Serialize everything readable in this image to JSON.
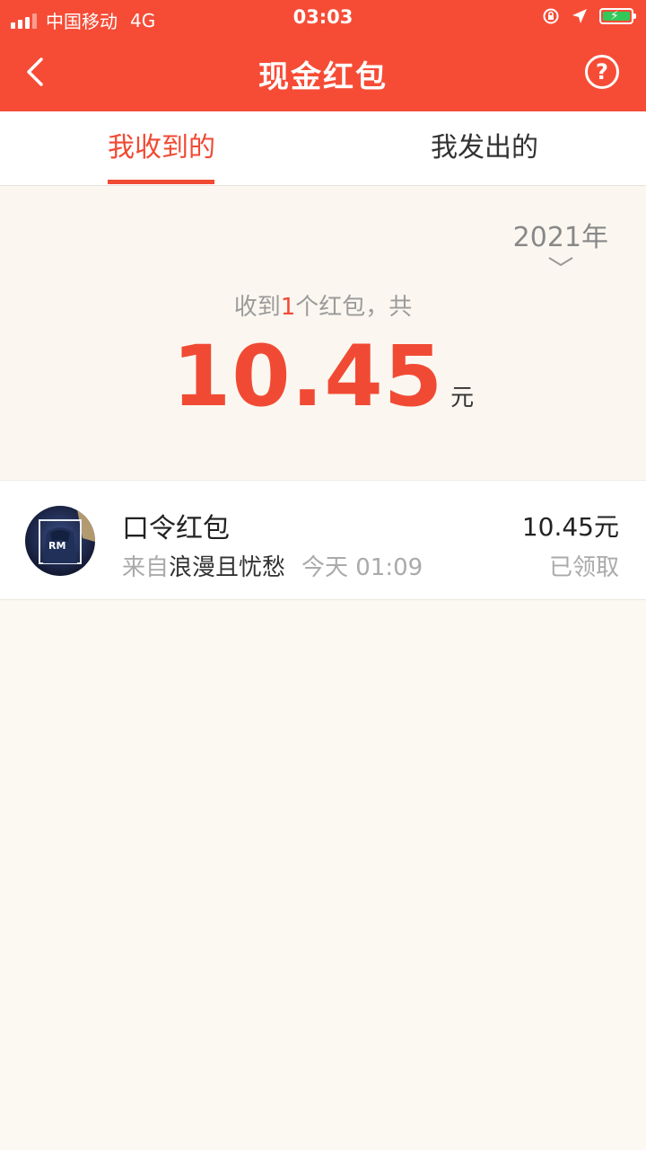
{
  "status_bar": {
    "carrier": "中国移动",
    "network": "4G",
    "time": "03:03"
  },
  "header": {
    "title": "现金红包",
    "back_icon": "chevron-left-icon",
    "help_icon": "question-circle-icon",
    "help_glyph": "?"
  },
  "tabs": [
    {
      "label": "我收到的",
      "active": true
    },
    {
      "label": "我发出的",
      "active": false
    }
  ],
  "summary": {
    "year": "2021年",
    "count_prefix": "收到",
    "count": "1",
    "count_suffix": "个红包，共",
    "amount": "10.45",
    "unit": "元"
  },
  "items": [
    {
      "title": "口令红包",
      "from_label": "来自",
      "sender": "浪漫且忧愁",
      "time": "今天 01:09",
      "amount": "10.45元",
      "status": "已领取"
    }
  ],
  "colors": {
    "primary": "#f64c36",
    "accent": "#f14a34",
    "background": "#fcf8f2"
  }
}
